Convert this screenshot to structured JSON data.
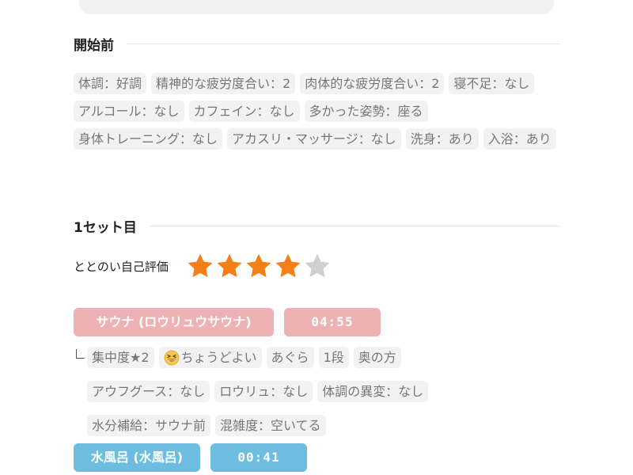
{
  "before": {
    "title": "開始前",
    "tags": [
      "体調：好調",
      "精神的な疲労度合い：2",
      "肉体的な疲労度合い：2",
      "寝不足：なし",
      "アルコール：なし",
      "カフェイン：なし",
      "多かった姿勢：座る",
      "身体トレーニング：なし",
      "アカスリ・マッサージ：なし",
      "洗身：あり",
      "入浴：あり"
    ]
  },
  "set1": {
    "title": "1セット目",
    "rating_label": "ととのい自己評価",
    "rating": 4,
    "rating_max": 5,
    "sauna": {
      "label": "サウナ (ロウリュウサウナ)",
      "time": "04:55",
      "tags_row1": [
        "集中度★2",
        "ちょうどよい",
        "あぐら",
        "1段",
        "奥の方"
      ],
      "tags_row2": [
        "アウフグース：なし",
        "ロウリュ：なし",
        "体調の異変：なし"
      ],
      "tags_row3": [
        "水分補給：サウナ前",
        "混雑度：空いてる"
      ]
    },
    "water": {
      "label": "水風呂 (水風呂)",
      "time": "00:41"
    }
  },
  "colors": {
    "star_on": "#f57f17",
    "star_off": "#cfcfcf",
    "sauna_pill": "#eeb1b4",
    "water_pill": "#6cbde0",
    "tag_bg": "#f2f2f2",
    "tag_text": "#777777"
  },
  "icons": [
    "grinning-squint-emoji"
  ]
}
